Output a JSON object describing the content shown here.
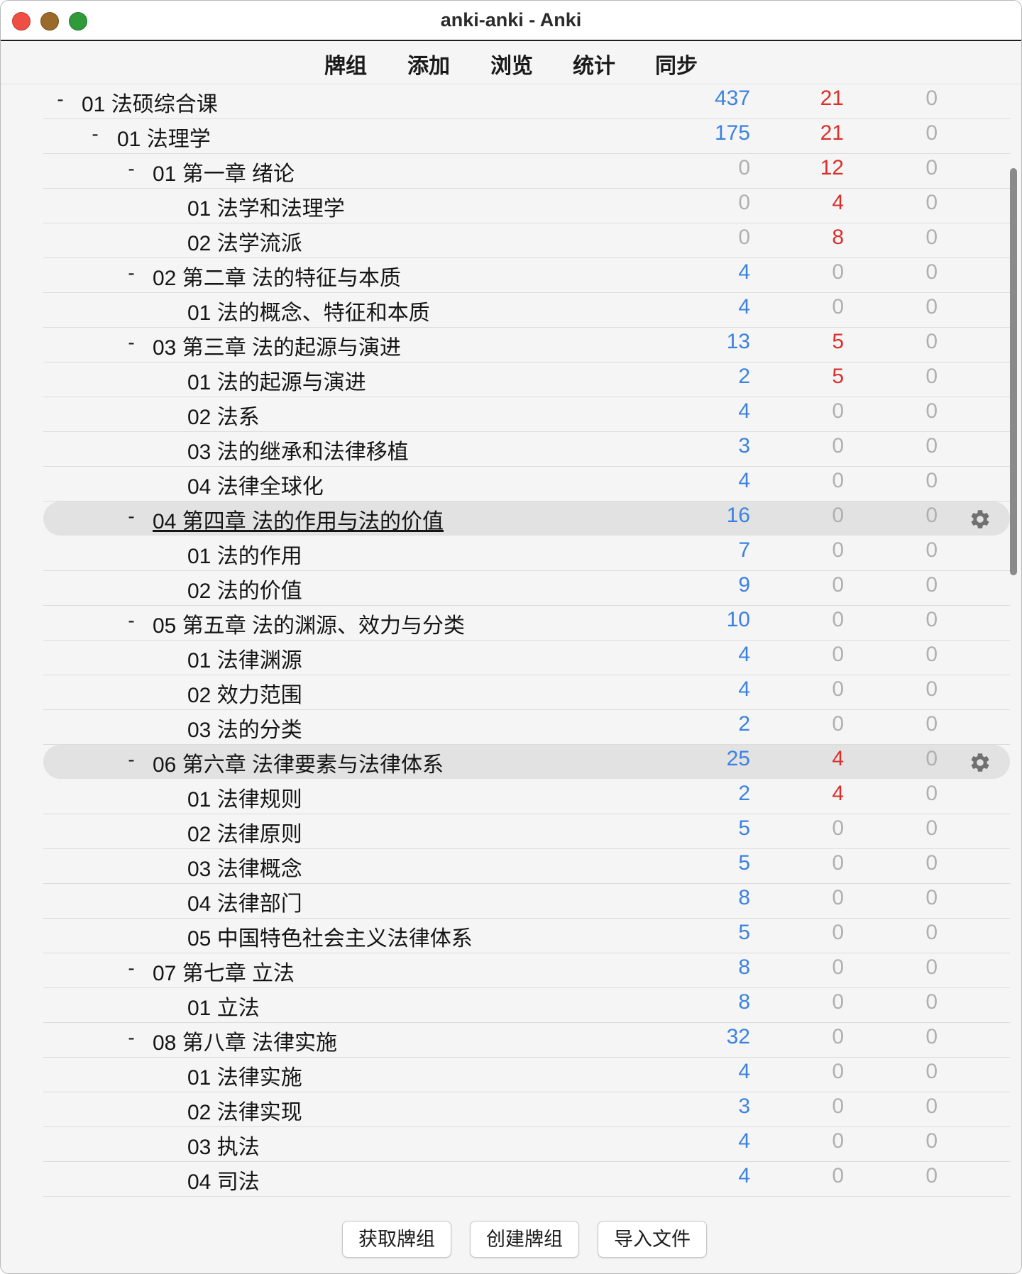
{
  "window": {
    "title": "anki-anki - Anki"
  },
  "toolbar": {
    "tabs": [
      "牌组",
      "添加",
      "浏览",
      "统计",
      "同步"
    ]
  },
  "decks": [
    {
      "name": "01 法硕综合课",
      "level": 0,
      "collapse": "-",
      "new": "437",
      "learn": "21",
      "due": "0"
    },
    {
      "name": "01 法理学",
      "level": 1,
      "collapse": "-",
      "new": "175",
      "learn": "21",
      "due": "0"
    },
    {
      "name": "01 第一章 绪论",
      "level": 2,
      "collapse": "-",
      "new": "0",
      "learn": "12",
      "due": "0"
    },
    {
      "name": "01 法学和法理学",
      "level": 3,
      "collapse": "",
      "new": "0",
      "learn": "4",
      "due": "0"
    },
    {
      "name": "02 法学流派",
      "level": 3,
      "collapse": "",
      "new": "0",
      "learn": "8",
      "due": "0"
    },
    {
      "name": "02 第二章 法的特征与本质",
      "level": 2,
      "collapse": "-",
      "new": "4",
      "learn": "0",
      "due": "0"
    },
    {
      "name": "01 法的概念、特征和本质",
      "level": 3,
      "collapse": "",
      "new": "4",
      "learn": "0",
      "due": "0"
    },
    {
      "name": "03 第三章 法的起源与演进",
      "level": 2,
      "collapse": "-",
      "new": "13",
      "learn": "5",
      "due": "0"
    },
    {
      "name": "01 法的起源与演进",
      "level": 3,
      "collapse": "",
      "new": "2",
      "learn": "5",
      "due": "0"
    },
    {
      "name": "02 法系",
      "level": 3,
      "collapse": "",
      "new": "4",
      "learn": "0",
      "due": "0"
    },
    {
      "name": "03 法的继承和法律移植",
      "level": 3,
      "collapse": "",
      "new": "3",
      "learn": "0",
      "due": "0"
    },
    {
      "name": "04 法律全球化",
      "level": 3,
      "collapse": "",
      "new": "4",
      "learn": "0",
      "due": "0"
    },
    {
      "name": "04 第四章 法的作用与法的价值",
      "level": 2,
      "collapse": "-",
      "new": "16",
      "learn": "0",
      "due": "0",
      "highlight": true,
      "current": true
    },
    {
      "name": "01 法的作用",
      "level": 3,
      "collapse": "",
      "new": "7",
      "learn": "0",
      "due": "0"
    },
    {
      "name": "02 法的价值",
      "level": 3,
      "collapse": "",
      "new": "9",
      "learn": "0",
      "due": "0"
    },
    {
      "name": "05 第五章 法的渊源、效力与分类",
      "level": 2,
      "collapse": "-",
      "new": "10",
      "learn": "0",
      "due": "0"
    },
    {
      "name": "01 法律渊源",
      "level": 3,
      "collapse": "",
      "new": "4",
      "learn": "0",
      "due": "0"
    },
    {
      "name": "02 效力范围",
      "level": 3,
      "collapse": "",
      "new": "4",
      "learn": "0",
      "due": "0"
    },
    {
      "name": "03 法的分类",
      "level": 3,
      "collapse": "",
      "new": "2",
      "learn": "0",
      "due": "0"
    },
    {
      "name": "06 第六章 法律要素与法律体系",
      "level": 2,
      "collapse": "-",
      "new": "25",
      "learn": "4",
      "due": "0",
      "highlight": true
    },
    {
      "name": "01 法律规则",
      "level": 3,
      "collapse": "",
      "new": "2",
      "learn": "4",
      "due": "0"
    },
    {
      "name": "02 法律原则",
      "level": 3,
      "collapse": "",
      "new": "5",
      "learn": "0",
      "due": "0"
    },
    {
      "name": "03 法律概念",
      "level": 3,
      "collapse": "",
      "new": "5",
      "learn": "0",
      "due": "0"
    },
    {
      "name": "04 法律部门",
      "level": 3,
      "collapse": "",
      "new": "8",
      "learn": "0",
      "due": "0"
    },
    {
      "name": "05 中国特色社会主义法律体系",
      "level": 3,
      "collapse": "",
      "new": "5",
      "learn": "0",
      "due": "0"
    },
    {
      "name": "07 第七章 立法",
      "level": 2,
      "collapse": "-",
      "new": "8",
      "learn": "0",
      "due": "0"
    },
    {
      "name": "01 立法",
      "level": 3,
      "collapse": "",
      "new": "8",
      "learn": "0",
      "due": "0"
    },
    {
      "name": "08 第八章 法律实施",
      "level": 2,
      "collapse": "-",
      "new": "32",
      "learn": "0",
      "due": "0"
    },
    {
      "name": "01 法律实施",
      "level": 3,
      "collapse": "",
      "new": "4",
      "learn": "0",
      "due": "0"
    },
    {
      "name": "02 法律实现",
      "level": 3,
      "collapse": "",
      "new": "3",
      "learn": "0",
      "due": "0"
    },
    {
      "name": "03 执法",
      "level": 3,
      "collapse": "",
      "new": "4",
      "learn": "0",
      "due": "0"
    },
    {
      "name": "04 司法",
      "level": 3,
      "collapse": "",
      "new": "4",
      "learn": "0",
      "due": "0"
    }
  ],
  "colors": {
    "new": "#3b82e0",
    "learn": "#d9302c",
    "zero": "#b0b0b0"
  },
  "icons": {
    "row_options": "gear-icon"
  },
  "bottom_buttons": [
    "获取牌组",
    "创建牌组",
    "导入文件"
  ]
}
